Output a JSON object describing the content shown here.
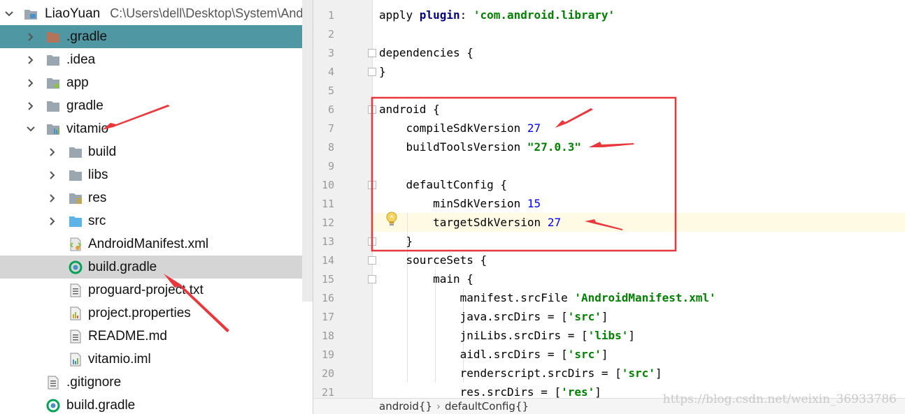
{
  "project_tree": {
    "root": {
      "name": "LiaoYuan",
      "path": "C:\\Users\\dell\\Desktop\\System\\Andr"
    },
    "items": [
      {
        "label": ".gradle",
        "icon": "folder-orange-icon",
        "arrow": "chevron-right-icon",
        "selected": true
      },
      {
        "label": ".idea",
        "icon": "folder-icon",
        "arrow": "chevron-right-icon"
      },
      {
        "label": "app",
        "icon": "module-folder-icon",
        "arrow": "chevron-right-icon"
      },
      {
        "label": "gradle",
        "icon": "folder-icon",
        "arrow": "chevron-right-icon"
      },
      {
        "label": "vitamio",
        "icon": "library-module-icon",
        "arrow": "chevron-down-icon"
      },
      {
        "label": "build",
        "icon": "folder-icon",
        "arrow": "chevron-right-icon"
      },
      {
        "label": "libs",
        "icon": "folder-icon",
        "arrow": "chevron-right-icon"
      },
      {
        "label": "res",
        "icon": "resources-folder-icon",
        "arrow": "chevron-right-icon"
      },
      {
        "label": "src",
        "icon": "source-folder-icon",
        "arrow": "chevron-right-icon"
      },
      {
        "label": "AndroidManifest.xml",
        "icon": "manifest-file-icon"
      },
      {
        "label": "build.gradle",
        "icon": "gradle-file-icon",
        "hover": true
      },
      {
        "label": "proguard-project.txt",
        "icon": "text-file-icon"
      },
      {
        "label": "project.properties",
        "icon": "properties-file-icon"
      },
      {
        "label": "README.md",
        "icon": "text-file-icon"
      },
      {
        "label": "vitamio.iml",
        "icon": "module-file-icon"
      },
      {
        "label": ".gitignore",
        "icon": "text-file-icon"
      },
      {
        "label": "build.gradle",
        "icon": "gradle-file-icon"
      }
    ]
  },
  "editor": {
    "lines": [
      {
        "n": "1",
        "t": [
          [
            "apply ",
            ""
          ],
          [
            "plugin",
            "kw"
          ],
          [
            ": ",
            ""
          ],
          [
            "'com.android.library'",
            "str"
          ]
        ]
      },
      {
        "n": "2",
        "t": []
      },
      {
        "n": "3",
        "t": [
          [
            "dependencies {",
            ""
          ]
        ]
      },
      {
        "n": "4",
        "t": [
          [
            "}",
            ""
          ]
        ]
      },
      {
        "n": "5",
        "t": []
      },
      {
        "n": "6",
        "t": [
          [
            "android {",
            ""
          ]
        ]
      },
      {
        "n": "7",
        "t": [
          [
            "    compileSdkVersion ",
            ""
          ],
          [
            "27",
            "num"
          ]
        ]
      },
      {
        "n": "8",
        "t": [
          [
            "    buildToolsVersion ",
            ""
          ],
          [
            "\"27.0.3\"",
            "str"
          ]
        ]
      },
      {
        "n": "9",
        "t": []
      },
      {
        "n": "10",
        "t": [
          [
            "    defaultConfig {",
            ""
          ]
        ]
      },
      {
        "n": "11",
        "t": [
          [
            "        minSdkVersion ",
            ""
          ],
          [
            "15",
            "num"
          ]
        ]
      },
      {
        "n": "12",
        "t": [
          [
            "        targetSdkVersion ",
            ""
          ],
          [
            "27",
            "num"
          ]
        ]
      },
      {
        "n": "13",
        "t": [
          [
            "    }",
            ""
          ]
        ]
      },
      {
        "n": "14",
        "t": [
          [
            "    sourceSets {",
            ""
          ]
        ]
      },
      {
        "n": "15",
        "t": [
          [
            "        main {",
            ""
          ]
        ]
      },
      {
        "n": "16",
        "t": [
          [
            "            manifest.srcFile ",
            ""
          ],
          [
            "'AndroidManifest.xml'",
            "str"
          ]
        ]
      },
      {
        "n": "17",
        "t": [
          [
            "            java.srcDirs = [",
            ""
          ],
          [
            "'src'",
            "str"
          ],
          [
            "]",
            ""
          ]
        ]
      },
      {
        "n": "18",
        "t": [
          [
            "            jniLibs.srcDirs = [",
            ""
          ],
          [
            "'libs'",
            "str"
          ],
          [
            "]",
            ""
          ]
        ]
      },
      {
        "n": "19",
        "t": [
          [
            "            aidl.srcDirs = [",
            ""
          ],
          [
            "'src'",
            "str"
          ],
          [
            "]",
            ""
          ]
        ]
      },
      {
        "n": "20",
        "t": [
          [
            "            renderscript.srcDirs = [",
            ""
          ],
          [
            "'src'",
            "str"
          ],
          [
            "]",
            ""
          ]
        ]
      },
      {
        "n": "21",
        "t": [
          [
            "            res.srcDirs = [",
            ""
          ],
          [
            "'res'",
            "str"
          ],
          [
            "]",
            ""
          ]
        ]
      }
    ],
    "fold_lines": [
      "3",
      "4",
      "6",
      "10",
      "13",
      "14",
      "15"
    ],
    "highlight_line": "12",
    "bulb_line": "12",
    "breadcrumb": [
      "android{}",
      "defaultConfig{}"
    ]
  },
  "watermark": "https://blog.csdn.net/weixin_36933786",
  "colors": {
    "selection": "#4f97a3",
    "annotation": "#e8383d",
    "keyword": "#000080",
    "string": "#008000",
    "number": "#0000ff"
  }
}
